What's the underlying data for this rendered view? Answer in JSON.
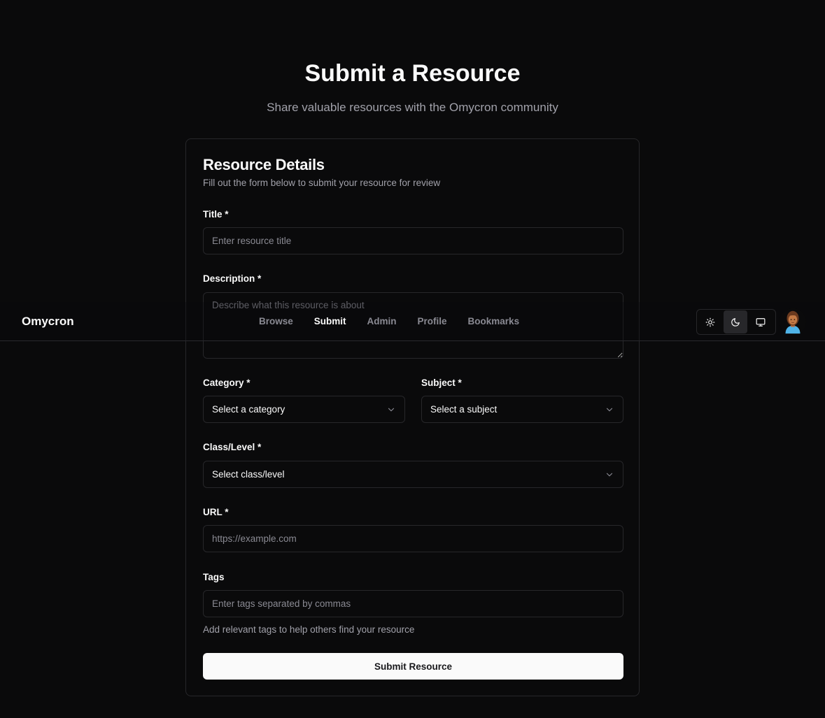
{
  "hero": {
    "title": "Submit a Resource",
    "subtitle": "Share valuable resources with the Omycron community"
  },
  "form": {
    "title": "Resource Details",
    "description": "Fill out the form below to submit your resource for review",
    "fields": {
      "title": {
        "label": "Title *",
        "placeholder": "Enter resource title",
        "value": ""
      },
      "description": {
        "label": "Description *",
        "placeholder": "Describe what this resource is about",
        "value": ""
      },
      "category": {
        "label": "Category *",
        "selected": "Select a category"
      },
      "subject": {
        "label": "Subject *",
        "selected": "Select a subject"
      },
      "class_level": {
        "label": "Class/Level *",
        "selected": "Select class/level"
      },
      "url": {
        "label": "URL *",
        "placeholder": "https://example.com",
        "value": ""
      },
      "tags": {
        "label": "Tags",
        "placeholder": "Enter tags separated by commas",
        "value": "",
        "helper": "Add relevant tags to help others find your resource"
      }
    },
    "submit_label": "Submit Resource"
  },
  "navbar": {
    "brand": "Omycron",
    "links": [
      {
        "label": "Browse",
        "active": false
      },
      {
        "label": "Submit",
        "active": true
      },
      {
        "label": "Admin",
        "active": false
      },
      {
        "label": "Profile",
        "active": false
      },
      {
        "label": "Bookmarks",
        "active": false
      }
    ],
    "theme_options": [
      {
        "icon": "sun-icon",
        "active": false
      },
      {
        "icon": "moon-icon",
        "active": true
      },
      {
        "icon": "monitor-icon",
        "active": false
      }
    ],
    "avatar_icon": "user-avatar"
  },
  "colors": {
    "background": "#0a0a0b",
    "border": "#27272a",
    "text": "#fafafa",
    "muted": "#a1a1aa",
    "button_bg": "#fafafa",
    "button_text": "#18181b"
  }
}
